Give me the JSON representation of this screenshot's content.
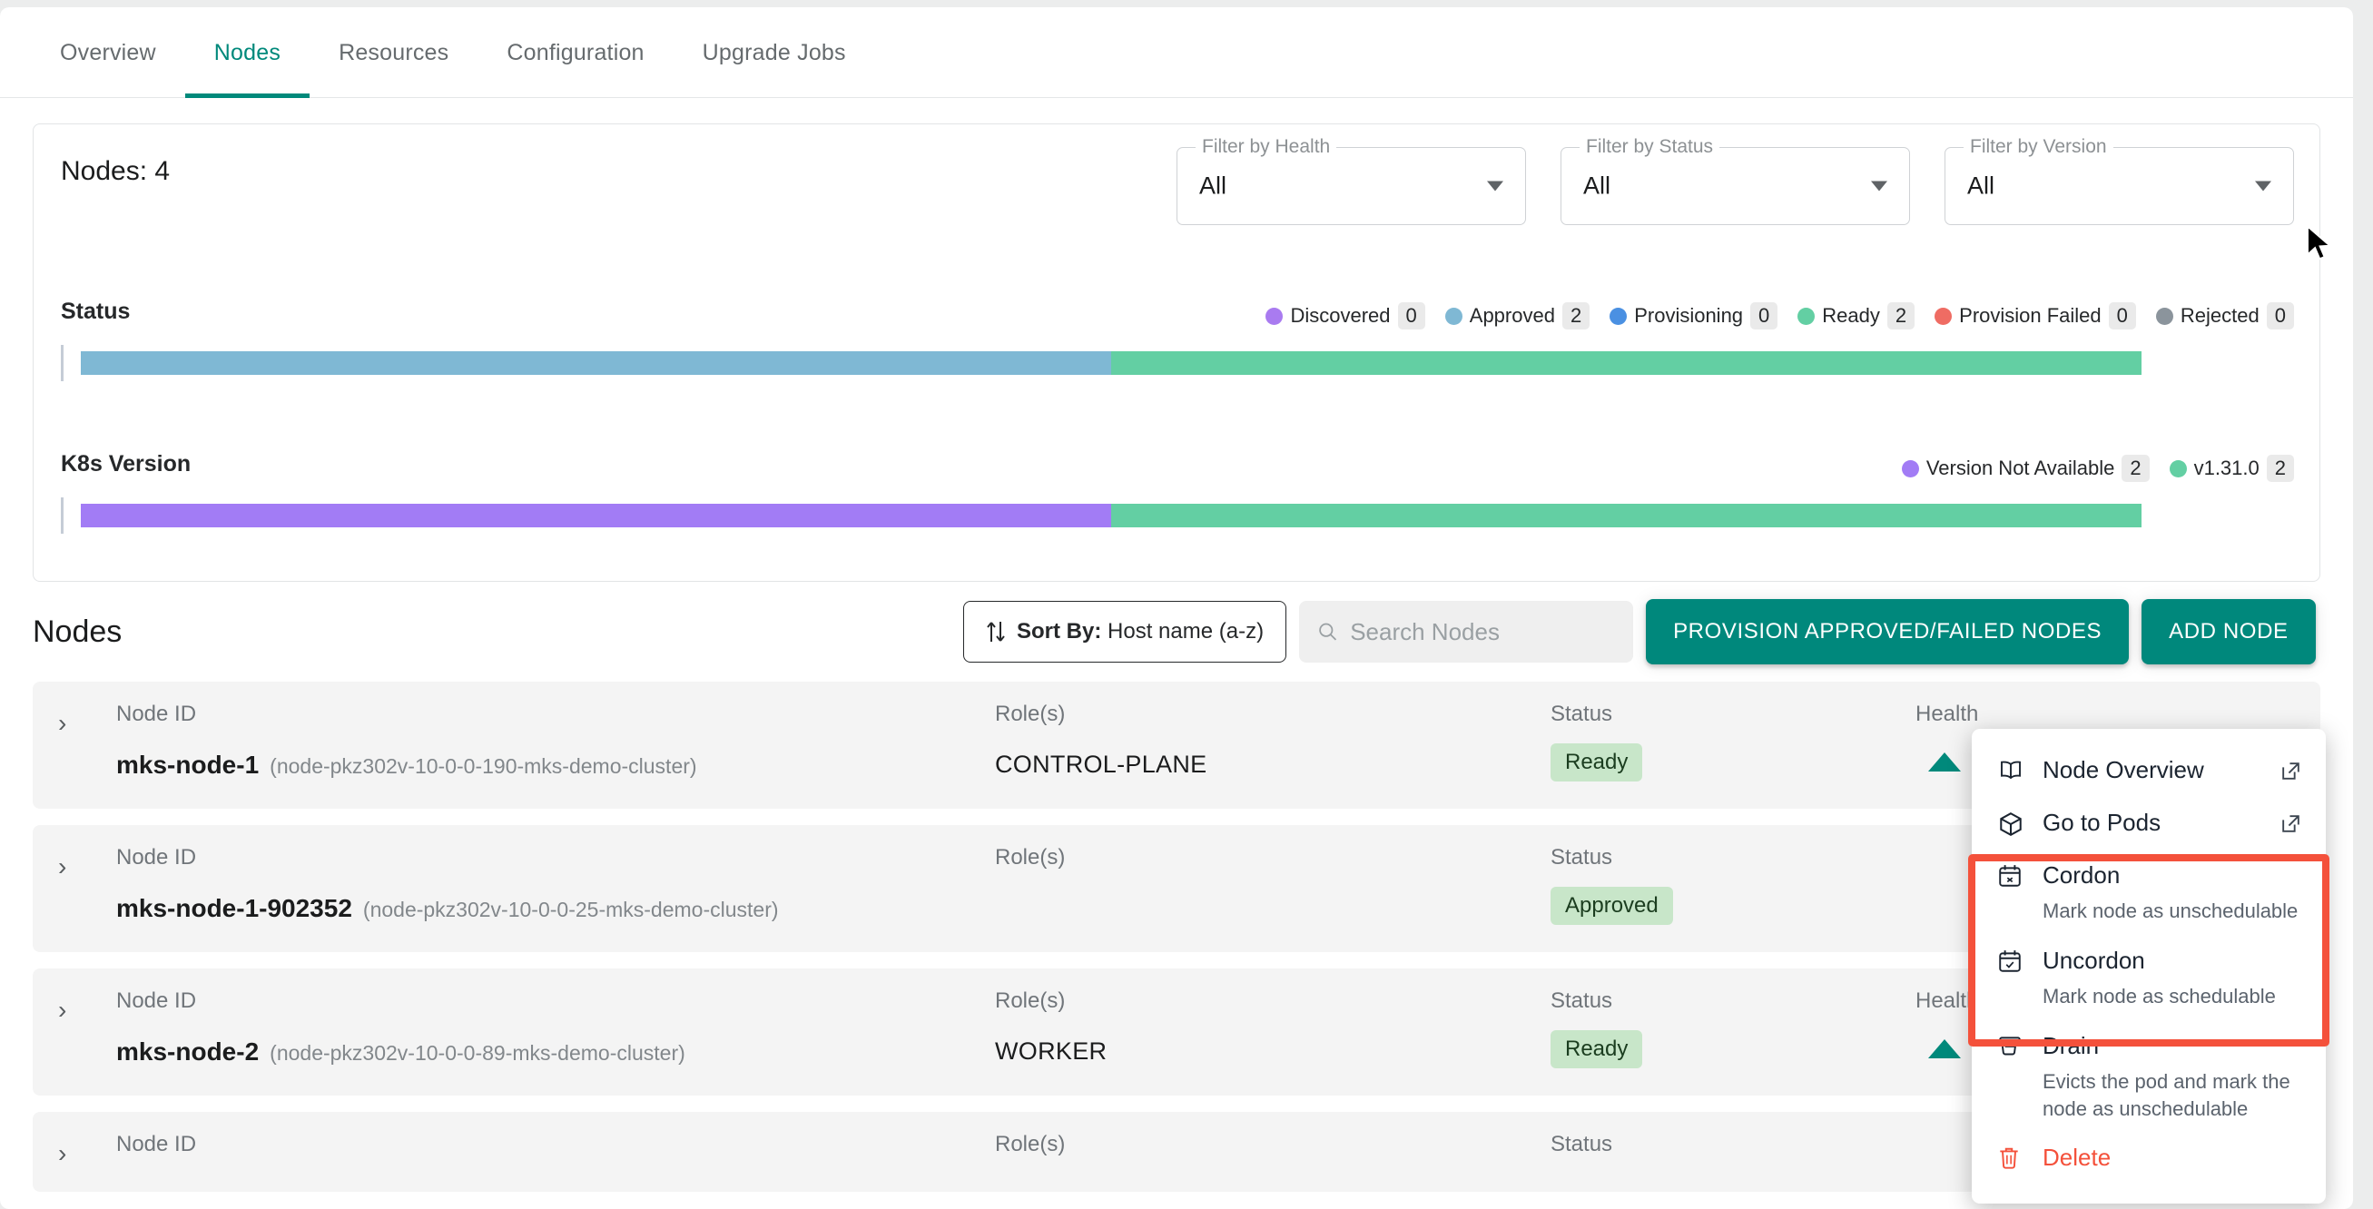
{
  "tabs": [
    {
      "label": "Overview",
      "active": false
    },
    {
      "label": "Nodes",
      "active": true
    },
    {
      "label": "Resources",
      "active": false
    },
    {
      "label": "Configuration",
      "active": false
    },
    {
      "label": "Upgrade Jobs",
      "active": false
    }
  ],
  "summary": {
    "nodes_count_label": "Nodes: 4",
    "filters": [
      {
        "legend": "Filter by Health",
        "value": "All"
      },
      {
        "legend": "Filter by Status",
        "value": "All"
      },
      {
        "legend": "Filter by Version",
        "value": "All"
      }
    ]
  },
  "chart_data": [
    {
      "type": "bar",
      "title": "Status",
      "orientation": "horizontal-stacked",
      "categories": [
        "Discovered",
        "Approved",
        "Provisioning",
        "Ready",
        "Provision Failed",
        "Rejected"
      ],
      "values": [
        0,
        2,
        0,
        2,
        0,
        0
      ],
      "colors": [
        "#a97bf0",
        "#7fb8d4",
        "#4a90e2",
        "#63cfa3",
        "#ef6c63",
        "#8b949c"
      ],
      "total": 4,
      "legend_position": "top-right",
      "xlabel": "",
      "ylabel": ""
    },
    {
      "type": "bar",
      "title": "K8s Version",
      "orientation": "horizontal-stacked",
      "categories": [
        "Version Not Available",
        "v1.31.0"
      ],
      "values": [
        2,
        2
      ],
      "colors": [
        "#a27cf5",
        "#63cfa3"
      ],
      "total": 4,
      "legend_position": "top-right",
      "xlabel": "",
      "ylabel": ""
    }
  ],
  "nodes_section": {
    "title": "Nodes",
    "sort_prefix": "Sort By:",
    "sort_value": "Host name (a-z)",
    "search_placeholder": "Search Nodes",
    "search_value": "",
    "provision_button": "PROVISION APPROVED/FAILED NODES",
    "add_button": "ADD NODE",
    "columns": {
      "id": "Node ID",
      "role": "Role(s)",
      "status": "Status",
      "health": "Health"
    },
    "rows": [
      {
        "name": "mks-node-1",
        "host": "(node-pkz302v-10-0-0-190-mks-demo-cluster)",
        "role": "CONTROL-PLANE",
        "status": "Ready",
        "health": "up"
      },
      {
        "name": "mks-node-1-902352",
        "host": "(node-pkz302v-10-0-0-25-mks-demo-cluster)",
        "role": "",
        "status": "Approved",
        "health": ""
      },
      {
        "name": "mks-node-2",
        "host": "(node-pkz302v-10-0-0-89-mks-demo-cluster)",
        "role": "WORKER",
        "status": "Ready",
        "health": "up"
      }
    ],
    "partial_row": {
      "id_label": "Node ID",
      "role_label": "Role(s)",
      "status_label": "Status"
    }
  },
  "context_menu": {
    "items": [
      {
        "label": "Node Overview",
        "desc": "",
        "icon": "book-icon",
        "external": true,
        "danger": false
      },
      {
        "label": "Go to Pods",
        "desc": "",
        "icon": "cube-icon",
        "external": true,
        "danger": false
      },
      {
        "label": "Cordon",
        "desc": "Mark node as unschedulable",
        "icon": "calendar-x-icon",
        "external": false,
        "danger": false
      },
      {
        "label": "Uncordon",
        "desc": "Mark node as schedulable",
        "icon": "calendar-check-icon",
        "external": false,
        "danger": false
      },
      {
        "label": "Drain",
        "desc": "Evicts the pod and mark the node as unschedulable",
        "icon": "drain-icon",
        "external": false,
        "danger": false
      },
      {
        "label": "Delete",
        "desc": "",
        "icon": "trash-icon",
        "external": false,
        "danger": true
      }
    ],
    "highlight_color": "#f4513b"
  },
  "theme": {
    "accent": "#00897b",
    "danger": "#f4513b",
    "badge_bg": "#c8e6c9"
  }
}
